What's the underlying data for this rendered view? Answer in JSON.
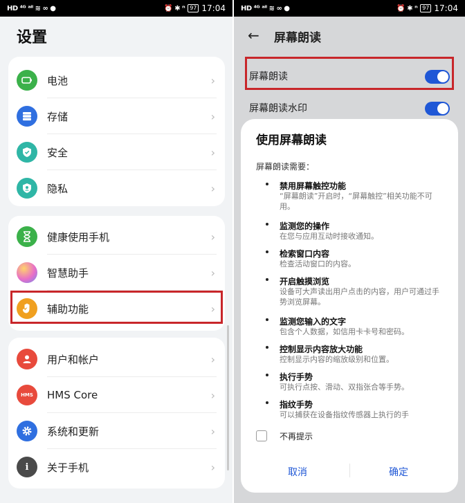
{
  "status_bar": {
    "left_glyphs": "HD ⁴ᴳ ᵃⁱˡ ≋ ∞ ●",
    "right_glyphs": "⏰ ✱ ⁿ",
    "battery": "97",
    "time": "17:04"
  },
  "settings_screen": {
    "title": "设置",
    "groups": [
      {
        "items": [
          {
            "label": "电池",
            "icon": "battery-icon",
            "color": "#3bb14a"
          },
          {
            "label": "存储",
            "icon": "storage-icon",
            "color": "#2f6fe0"
          },
          {
            "label": "安全",
            "icon": "shield-icon",
            "color": "#2fb6a6"
          },
          {
            "label": "隐私",
            "icon": "privacy-icon",
            "color": "#2fb6a6"
          }
        ]
      },
      {
        "items": [
          {
            "label": "健康使用手机",
            "icon": "hourglass-icon",
            "color": "#3bb14a"
          },
          {
            "label": "智慧助手",
            "icon": "assistant-orb-icon",
            "color": "#c07bd8"
          },
          {
            "label": "辅助功能",
            "icon": "accessibility-hand-icon",
            "color": "#f0a020"
          }
        ]
      },
      {
        "items": [
          {
            "label": "用户和帐户",
            "icon": "user-icon",
            "color": "#e84a3c"
          },
          {
            "label": "HMS Core",
            "icon": "hms-icon",
            "color": "#e84a3c"
          },
          {
            "label": "系统和更新",
            "icon": "gear-icon",
            "color": "#2f6fe0"
          },
          {
            "label": "关于手机",
            "icon": "info-icon",
            "color": "#4a4a4a"
          }
        ]
      }
    ]
  },
  "screen_reader": {
    "title": "屏幕朗读",
    "rows": [
      {
        "label": "屏幕朗读",
        "on": true
      },
      {
        "label": "屏幕朗读水印",
        "on": true
      }
    ],
    "dialog": {
      "title": "使用屏幕朗读",
      "intro": "屏幕朗读需要：",
      "permissions": [
        {
          "title": "禁用屏幕触控功能",
          "desc": "“屏幕朗读”开启时，“屏幕触控”相关功能不可用。"
        },
        {
          "title": "监测您的操作",
          "desc": "在您与应用互动时接收通知。"
        },
        {
          "title": "检索窗口内容",
          "desc": "检查活动窗口的内容。"
        },
        {
          "title": "开启触摸浏览",
          "desc": "设备可大声读出用户点击的内容，用户可通过手势浏览屏幕。"
        },
        {
          "title": "监测您输入的文字",
          "desc": "包含个人数据，如信用卡卡号和密码。"
        },
        {
          "title": "控制显示内容放大功能",
          "desc": "控制显示内容的缩放级别和位置。"
        },
        {
          "title": "执行手势",
          "desc": "可执行点按、滑动、双指张合等手势。"
        },
        {
          "title": "指纹手势",
          "desc": "可以捕获在设备指纹传感器上执行的手"
        }
      ],
      "checkbox_label": "不再提示",
      "cancel_label": "取消",
      "ok_label": "确定"
    }
  },
  "colors": {
    "accent": "#1f57d6",
    "highlight": "#c8262a"
  }
}
